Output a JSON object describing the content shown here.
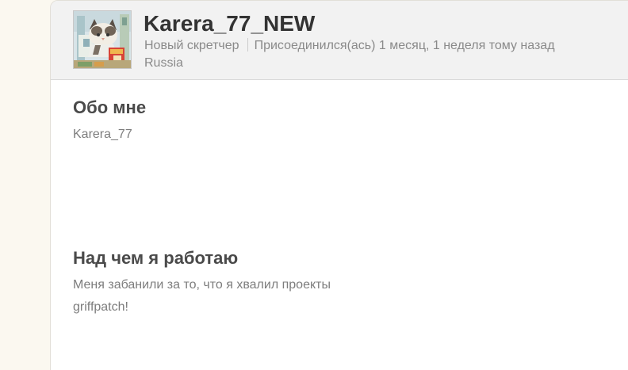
{
  "profile": {
    "username": "Karera_77_NEW",
    "status": "Новый скретчер",
    "joined": "Присоединился(ась) 1 месяц, 1 неделя тому назад",
    "location": "Russia",
    "avatar_icon": "cat-avatar-icon"
  },
  "about": {
    "title": "Обо мне",
    "text": "Karera_77"
  },
  "working_on": {
    "title": "Над чем я работаю",
    "text": "Меня забанили за то, что я хвалил проекты griffpatch!"
  },
  "colors": {
    "page_background": "#fbf8f0",
    "header_background": "#f2f2f2",
    "title_text": "#333333",
    "muted_text": "#8a8a8a"
  }
}
